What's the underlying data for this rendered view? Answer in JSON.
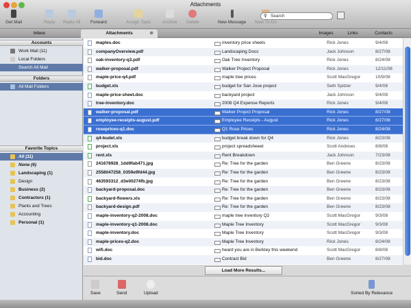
{
  "window": {
    "title": "Attachments"
  },
  "toolbar": {
    "get_mail": "Get Mail",
    "reply": "Reply",
    "reply_all": "Reply All",
    "forward": "Forward",
    "assign_topic": "Assign Topic",
    "archive": "Archive",
    "delete": "Delete",
    "new_message": "New Message",
    "new_todo": "New To-Do",
    "search_placeholder": "Search"
  },
  "tabs": {
    "inbox": "Inbox",
    "attachments": "Attachments",
    "images": "Images",
    "links": "Links",
    "contacts": "Contacts"
  },
  "sidebar": {
    "accounts_header": "Accounts",
    "accounts": [
      "Work Mail (11)",
      "Local Folders",
      "Search All Mail"
    ],
    "folders_header": "Folders",
    "folders": [
      "All Mail Folders"
    ],
    "topics_header": "Favorite Topics",
    "topics": [
      "All (11)",
      "None (6)",
      "Landscaping (1)",
      "Design",
      "Business (2)",
      "Contractors (1)",
      "Plants and Trees",
      "Accounting",
      "Personal (1)"
    ]
  },
  "rows": [
    {
      "file": "maples.doc",
      "type": "doc",
      "subject": "inventory price sheets",
      "from": "Rick Jones",
      "date": "9/4/08"
    },
    {
      "file": "companyOverview.pdf",
      "type": "pdf",
      "subject": "Landscaping Docs",
      "from": "Jack Johnson",
      "date": "8/27/08"
    },
    {
      "file": "oak-inventory-q3.pdf",
      "type": "pdf",
      "subject": "Oak Tree Inventory",
      "from": "Rick Jones",
      "date": "8/24/08"
    },
    {
      "file": "walker-proposal.pdf",
      "type": "pdf",
      "subject": "Walker Project Proposal",
      "from": "Rick Jones",
      "date": "12/11/08"
    },
    {
      "file": "maple-price-q4.pdf",
      "type": "pdf",
      "subject": "maple tree prices",
      "from": "Scott MacGregor",
      "date": "10/9/08"
    },
    {
      "file": "budget.xls",
      "type": "xls",
      "subject": "budget for San Jose project",
      "from": "Seth Spitzer",
      "date": "9/4/08"
    },
    {
      "file": "maple-price-sheet.doc",
      "type": "doc",
      "subject": "backyard project",
      "from": "Jack Johnson",
      "date": "9/4/08"
    },
    {
      "file": "tree-inventory.doc",
      "type": "doc",
      "subject": "2008 Q4 Expense Reports",
      "from": "Rick Jones",
      "date": "9/4/08"
    },
    {
      "file": "walker-proposal.pdf",
      "type": "pdf",
      "subject": "Walker Project Proposal",
      "from": "Rick Jones",
      "date": "8/27/08",
      "selected": true
    },
    {
      "file": "employee-receipts-august.pdf",
      "type": "pdf",
      "subject": "Employee Receipts - August",
      "from": "Rick Jones",
      "date": "8/27/08",
      "selected": true
    },
    {
      "file": "roseprices-q1.doc",
      "type": "doc",
      "subject": "Q1 Rose Prices",
      "from": "Rick Jones",
      "date": "8/24/08",
      "selected": true
    },
    {
      "file": "q4-budet.xls",
      "type": "xls",
      "subject": "budget break down for Q4",
      "from": "Rick Jones",
      "date": "8/23/08"
    },
    {
      "file": "project.xls",
      "type": "xls",
      "subject": "project spreadsheeet",
      "from": "Scott Andrews",
      "date": "8/8/08"
    },
    {
      "file": "rent.xls",
      "type": "xls",
      "subject": "Rent Breakdown",
      "from": "Jack Johnson",
      "date": "7/23/08"
    },
    {
      "file": "241678928_1dd9fab471.jpg",
      "type": "jpg",
      "subject": "Re: Tree for the garden",
      "from": "Ben Greene",
      "date": "8/23/08"
    },
    {
      "file": "2558047258_0359e9fd44.jpg",
      "type": "jpg",
      "subject": "Re: Tree for the garden",
      "from": "Ben Greene",
      "date": "8/23/08"
    },
    {
      "file": "463593312_d3e00274fb.jpg",
      "type": "jpg",
      "subject": "Re: Tree for the garden",
      "from": "Ben Greene",
      "date": "8/23/08"
    },
    {
      "file": "backyard-proposal.doc",
      "type": "doc",
      "subject": "Re: Tree for the garden",
      "from": "Ben Greene",
      "date": "8/23/08"
    },
    {
      "file": "backyard-flowers.xls",
      "type": "xls",
      "subject": "Re: Tree for the garden",
      "from": "Ben Greene",
      "date": "8/23/08"
    },
    {
      "file": "backyard-design.pdf",
      "type": "pdf",
      "subject": "Re: Tree for the garden",
      "from": "Ben Greene",
      "date": "8/23/08"
    },
    {
      "file": "maple-inventory-q2-2008.doc",
      "type": "doc",
      "subject": "maple tree inventory Q2",
      "from": "Scott MacGregor",
      "date": "9/3/08"
    },
    {
      "file": "maple-inventory-q1-2008.doc",
      "type": "doc",
      "subject": "Maple Tree Inventory",
      "from": "Scott MacGregor",
      "date": "9/3/08"
    },
    {
      "file": "maple-inventory.doc",
      "type": "doc",
      "subject": "Maple Tree Inventory",
      "from": "Scott MacGregor",
      "date": "9/3/08"
    },
    {
      "file": "maple-prices-q2.doc",
      "type": "doc",
      "subject": "Maple Tree Inventory",
      "from": "Rick Jones",
      "date": "8/24/08"
    },
    {
      "file": "wifi.doc",
      "type": "doc",
      "subject": "heard you are in Berkley this weekend",
      "from": "Scott MacGregor",
      "date": "8/8/08"
    },
    {
      "file": "bid.doc",
      "type": "doc",
      "subject": "Contract Bid",
      "from": "Ben Greene",
      "date": "8/27/08"
    }
  ],
  "load_more": "Load More Results...",
  "bottom": {
    "save": "Save",
    "send": "Send",
    "upload": "Upload",
    "sort": "Sorted By Relevance"
  },
  "colors": {
    "selection": "#3a6fd2",
    "sidebar_selection": "#5f7aa8"
  }
}
